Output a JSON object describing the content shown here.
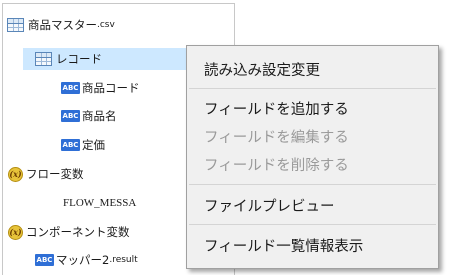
{
  "tree": {
    "file": {
      "icon": "table-icon",
      "label": "商品マスター",
      "ext": ".csv"
    },
    "record": {
      "icon": "table-icon",
      "label": "レコード"
    },
    "fields": [
      {
        "icon": "abc-type-icon",
        "icon_text": "ABC",
        "label": "商品コード"
      },
      {
        "icon": "abc-type-icon",
        "icon_text": "ABC",
        "label": "商品名"
      },
      {
        "icon": "abc-type-icon",
        "icon_text": "ABC",
        "label": "定価"
      }
    ],
    "flow_vars": {
      "icon": "variable-icon",
      "icon_text": "(x)",
      "label": "フロー変数"
    },
    "flow_message": {
      "label": "FLOW_MESSA"
    },
    "component_vars": {
      "icon": "variable-icon",
      "icon_text": "(x)",
      "label": "コンポーネント変数"
    },
    "mapper": {
      "icon": "abc-type-icon",
      "icon_text": "ABC",
      "label": "マッパー2",
      "ext": ".result"
    }
  },
  "context_menu": {
    "items": [
      {
        "label": "読み込み設定変更",
        "enabled": true
      },
      {
        "label": "フィールドを追加する",
        "enabled": true
      },
      {
        "label": "フィールドを編集する",
        "enabled": false
      },
      {
        "label": "フィールドを削除する",
        "enabled": false
      },
      {
        "label": "ファイルプレビュー",
        "enabled": true
      },
      {
        "label": "フィールド一覧情報表示",
        "enabled": true
      }
    ]
  },
  "colors": {
    "selection": "#cde8ff",
    "menu_bg": "#f0f0f0",
    "abc_badge": "#2f6fd6",
    "variable_badge": "#e8c43a",
    "disabled_text": "#9a9a9a"
  }
}
